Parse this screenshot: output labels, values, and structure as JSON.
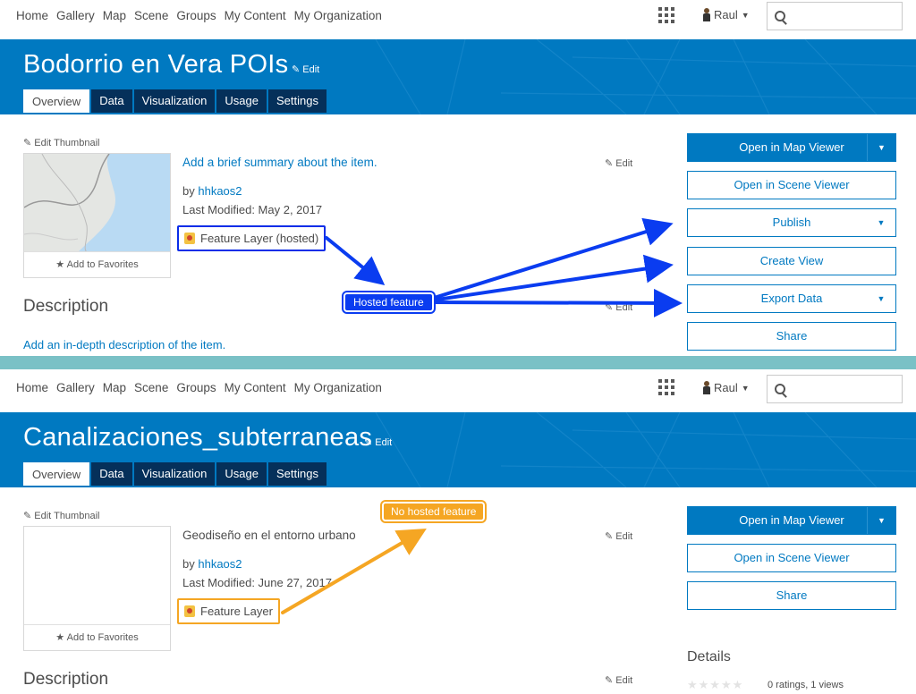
{
  "nav": {
    "links": [
      "Home",
      "Gallery",
      "Map",
      "Scene",
      "Groups",
      "My Content",
      "My Organization"
    ],
    "user": "Raul",
    "search_placeholder": ""
  },
  "panel1": {
    "title": "Bodorrio en Vera POIs",
    "title_edit": "Edit",
    "tabs": [
      "Overview",
      "Data",
      "Visualization",
      "Usage",
      "Settings"
    ],
    "edit_thumbnail": "Edit Thumbnail",
    "add_to_favorites": "Add to Favorites",
    "summary": "Add a brief summary about the item.",
    "by_prefix": "by",
    "owner": "hhkaos2",
    "last_modified": "Last Modified: May 2, 2017",
    "item_type": "Feature Layer (hosted)",
    "edit": "Edit",
    "description_title": "Description",
    "description_link": "Add an in-depth description of the item.",
    "buttons": {
      "open_map_viewer": "Open in Map Viewer",
      "open_scene_viewer": "Open in Scene Viewer",
      "publish": "Publish",
      "create_view": "Create View",
      "export_data": "Export Data",
      "share": "Share"
    },
    "callout": "Hosted feature"
  },
  "panel2": {
    "title": "Canalizaciones_subterraneas",
    "title_edit": "Edit",
    "tabs": [
      "Overview",
      "Data",
      "Visualization",
      "Usage",
      "Settings"
    ],
    "edit_thumbnail": "Edit Thumbnail",
    "add_to_favorites": "Add to Favorites",
    "summary": "Geodiseño en el entorno urbano",
    "by_prefix": "by",
    "owner": "hhkaos2",
    "last_modified": "Last Modified: June 27, 2017",
    "item_type": "Feature Layer",
    "edit": "Edit",
    "description_title": "Description",
    "buttons": {
      "open_map_viewer": "Open in Map Viewer",
      "open_scene_viewer": "Open in Scene Viewer",
      "share": "Share"
    },
    "callout": "No hosted feature",
    "details_title": "Details",
    "ratings": "0 ratings, 1 views",
    "rating_value": 0
  },
  "colors": {
    "brand_blue": "#0079c1",
    "tab_dark": "#05305a",
    "callout_blue": "#0a3cf0",
    "callout_orange": "#f5a623",
    "divider": "#7ac1c6"
  }
}
